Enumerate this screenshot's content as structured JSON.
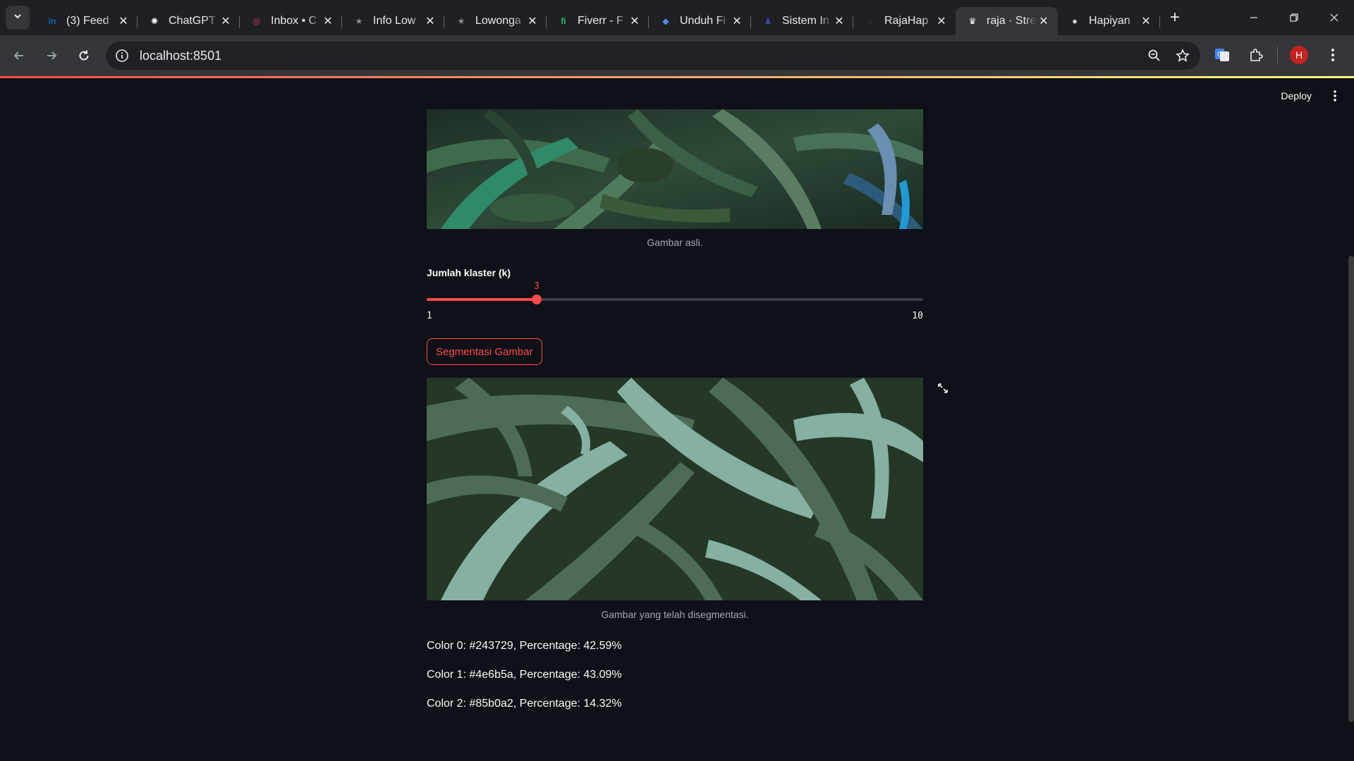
{
  "browser": {
    "tabs": [
      {
        "title": "(3) Feed",
        "icon": "linkedin-icon",
        "color": "#0a66c2",
        "glyph": "in"
      },
      {
        "title": "ChatGPT",
        "icon": "chatgpt-icon",
        "color": "#ffffff",
        "glyph": "✺"
      },
      {
        "title": "Inbox • C",
        "icon": "instagram-icon",
        "color": "#e1306c",
        "glyph": "◎"
      },
      {
        "title": "Info Low",
        "icon": "star-logo-icon",
        "color": "#8a8d91",
        "glyph": "★"
      },
      {
        "title": "Lowonga",
        "icon": "star-logo-icon",
        "color": "#8a8d91",
        "glyph": "★"
      },
      {
        "title": "Fiverr - F",
        "icon": "fiverr-icon",
        "color": "#1dbf73",
        "glyph": "fi"
      },
      {
        "title": "Unduh Fi",
        "icon": "diamond-icon",
        "color": "#4a90e2",
        "glyph": "◆"
      },
      {
        "title": "Sistem In",
        "icon": "person-icon",
        "color": "#3949ab",
        "glyph": "♟"
      },
      {
        "title": "RajaHap",
        "icon": "loading-icon",
        "color": "#5f6368",
        "glyph": "◌"
      },
      {
        "title": "raja · Stre",
        "icon": "streamlit-crown-icon",
        "color": "#ffffff",
        "glyph": "♛"
      },
      {
        "title": "Hapiyan",
        "icon": "github-icon",
        "color": "#ffffff",
        "glyph": "●"
      }
    ],
    "active_tab": 9,
    "url": "localhost:8501",
    "avatar_letter": "H"
  },
  "app": {
    "deploy_label": "Deploy",
    "original_caption": "Gambar asli.",
    "slider": {
      "label": "Jumlah klaster (k)",
      "value": 3,
      "min": 1,
      "max": 10
    },
    "segment_button": "Segmentasi Gambar",
    "segmented_caption": "Gambar yang telah disegmentasi.",
    "colors": [
      {
        "text": "Color 0: #243729, Percentage: 42.59%",
        "hex": "#243729",
        "percentage": 42.59
      },
      {
        "text": "Color 1: #4e6b5a, Percentage: 43.09%",
        "hex": "#4e6b5a",
        "percentage": 43.09
      },
      {
        "text": "Color 2: #85b0a2, Percentage: 14.32%",
        "hex": "#85b0a2",
        "percentage": 14.32
      }
    ]
  }
}
